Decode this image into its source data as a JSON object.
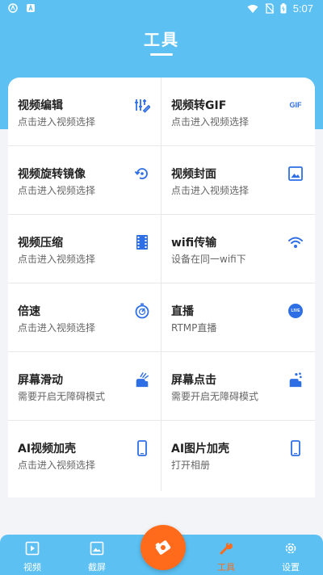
{
  "status": {
    "time": "5:07"
  },
  "header": {
    "title": "工具"
  },
  "tools": [
    {
      "title": "视频编辑",
      "subtitle": "点击进入视频选择",
      "icon": "edit-sliders-icon"
    },
    {
      "title": "视频转GIF",
      "subtitle": "点击进入视频选择",
      "icon": "gif-icon",
      "icon_text": "GIF"
    },
    {
      "title": "视频旋转镜像",
      "subtitle": "点击进入视频选择",
      "icon": "rotate-icon"
    },
    {
      "title": "视频封面",
      "subtitle": "点击进入视频选择",
      "icon": "image-icon"
    },
    {
      "title": "视频压缩",
      "subtitle": "点击进入视频选择",
      "icon": "film-icon"
    },
    {
      "title": "wifi传输",
      "subtitle": "设备在同一wifi下",
      "icon": "wifi-icon"
    },
    {
      "title": "倍速",
      "subtitle": "点击进入视频选择",
      "icon": "timer-icon"
    },
    {
      "title": "直播",
      "subtitle": "RTMP直播",
      "icon": "live-icon",
      "icon_text": "LIVE"
    },
    {
      "title": "屏幕滑动",
      "subtitle": "需要开启无障碍模式",
      "icon": "swipe-hand-icon"
    },
    {
      "title": "屏幕点击",
      "subtitle": "需要开启无障碍模式",
      "icon": "tap-hand-icon"
    },
    {
      "title": "AI视频加壳",
      "subtitle": "点击进入视频选择",
      "icon": "phone-icon"
    },
    {
      "title": "AI图片加壳",
      "subtitle": "打开相册",
      "icon": "phone-icon"
    }
  ],
  "nav": {
    "items": [
      {
        "label": "视频",
        "icon": "video-icon"
      },
      {
        "label": "截屏",
        "icon": "screenshot-icon"
      },
      {
        "label": "工具",
        "icon": "wrench-icon",
        "active": true
      },
      {
        "label": "设置",
        "icon": "gear-icon"
      }
    ],
    "fab_icon": "record-icon"
  },
  "colors": {
    "primary": "#5cc0f2",
    "accent": "#ff6b1a",
    "icon_blue": "#2f6fe6"
  }
}
